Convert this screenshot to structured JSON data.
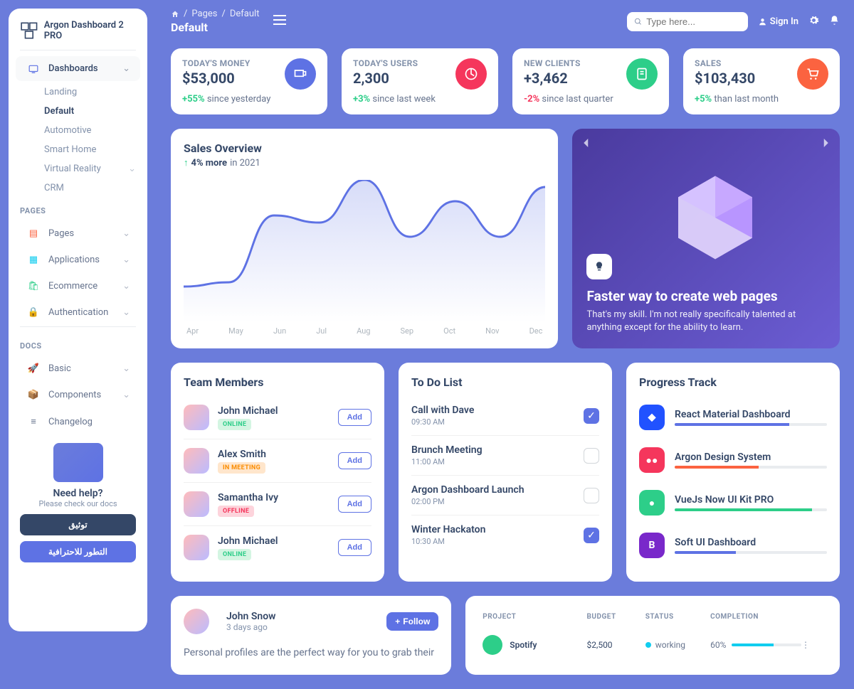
{
  "brand": "Argon Dashboard 2 PRO",
  "breadcrumb": {
    "pages": "Pages",
    "current": "Default"
  },
  "page_title": "Default",
  "search": {
    "placeholder": "Type here..."
  },
  "signin": "Sign In",
  "sidebar": {
    "dashboards": "Dashboards",
    "subs": {
      "landing": "Landing",
      "default": "Default",
      "automotive": "Automotive",
      "smart": "Smart Home",
      "vr": "Virtual Reality",
      "crm": "CRM"
    },
    "pages_label": "PAGES",
    "pages": "Pages",
    "applications": "Applications",
    "ecommerce": "Ecommerce",
    "authentication": "Authentication",
    "docs_label": "DOCS",
    "basic": "Basic",
    "components": "Components",
    "changelog": "Changelog",
    "help": {
      "title": "Need help?",
      "sub": "Please check our docs",
      "btn1": "توثيق",
      "btn2": "التطور للاحترافية"
    }
  },
  "stats": [
    {
      "label": "TODAY'S MONEY",
      "value": "$53,000",
      "pct": "+55%",
      "pos": true,
      "rest": " since yesterday",
      "icon_bg": "bg-primary"
    },
    {
      "label": "TODAY'S USERS",
      "value": "2,300",
      "pct": "+3%",
      "pos": true,
      "rest": " since last week",
      "icon_bg": "bg-danger"
    },
    {
      "label": "NEW CLIENTS",
      "value": "+3,462",
      "pct": "-2%",
      "pos": false,
      "rest": " since last quarter",
      "icon_bg": "bg-success"
    },
    {
      "label": "SALES",
      "value": "$103,430",
      "pct": "+5%",
      "pos": true,
      "rest": " than last month",
      "icon_bg": "bg-warning"
    }
  ],
  "overview": {
    "title": "Sales Overview",
    "pct": "4% more",
    "year": "in 2021"
  },
  "chart_data": {
    "type": "line",
    "categories": [
      "Apr",
      "May",
      "Jun",
      "Jul",
      "Aug",
      "Sep",
      "Oct",
      "Nov",
      "Dec"
    ],
    "values": [
      25,
      28,
      75,
      70,
      100,
      60,
      85,
      60,
      95
    ],
    "ylim": [
      0,
      100
    ]
  },
  "promo": {
    "title": "Faster way to create web pages",
    "text": "That's my skill. I'm not really specifically talented at anything except for the ability to learn."
  },
  "team": {
    "title": "Team Members",
    "add": "Add",
    "members": [
      {
        "name": "John Michael",
        "status": "ONLINE",
        "cls": "online"
      },
      {
        "name": "Alex Smith",
        "status": "IN MEETING",
        "cls": "meeting"
      },
      {
        "name": "Samantha Ivy",
        "status": "OFFLINE",
        "cls": "offline"
      },
      {
        "name": "John Michael",
        "status": "ONLINE",
        "cls": "online"
      }
    ]
  },
  "todo": {
    "title": "To Do List",
    "items": [
      {
        "name": "Call with Dave",
        "time": "09:30 AM",
        "checked": true
      },
      {
        "name": "Brunch Meeting",
        "time": "11:00 AM",
        "checked": false
      },
      {
        "name": "Argon Dashboard Launch",
        "time": "02:00 PM",
        "checked": false
      },
      {
        "name": "Winter Hackaton",
        "time": "10:30 AM",
        "checked": true
      }
    ]
  },
  "progress": {
    "title": "Progress Track",
    "items": [
      {
        "name": "React Material Dashboard",
        "color": "#5e72e4",
        "pct": 75,
        "ico_bg": "#2152ff"
      },
      {
        "name": "Argon Design System",
        "color": "#fb6340",
        "pct": 55,
        "ico_bg": "#f5365c"
      },
      {
        "name": "VueJs Now UI Kit PRO",
        "color": "#2dce89",
        "pct": 90,
        "ico_bg": "#2dce89"
      },
      {
        "name": "Soft UI Dashboard",
        "color": "#5e72e4",
        "pct": 40,
        "ico_bg": "#7928ca"
      }
    ]
  },
  "post": {
    "name": "John Snow",
    "time": "3 days ago",
    "follow": "Follow",
    "body": "Personal profiles are the perfect way for you to grab their"
  },
  "projects": {
    "head": {
      "project": "PROJECT",
      "budget": "BUDGET",
      "status": "STATUS",
      "completion": "COMPLETION"
    },
    "row": {
      "name": "Spotify",
      "budget": "$2,500",
      "status": "working",
      "completion": "60%",
      "pct": 60
    }
  }
}
